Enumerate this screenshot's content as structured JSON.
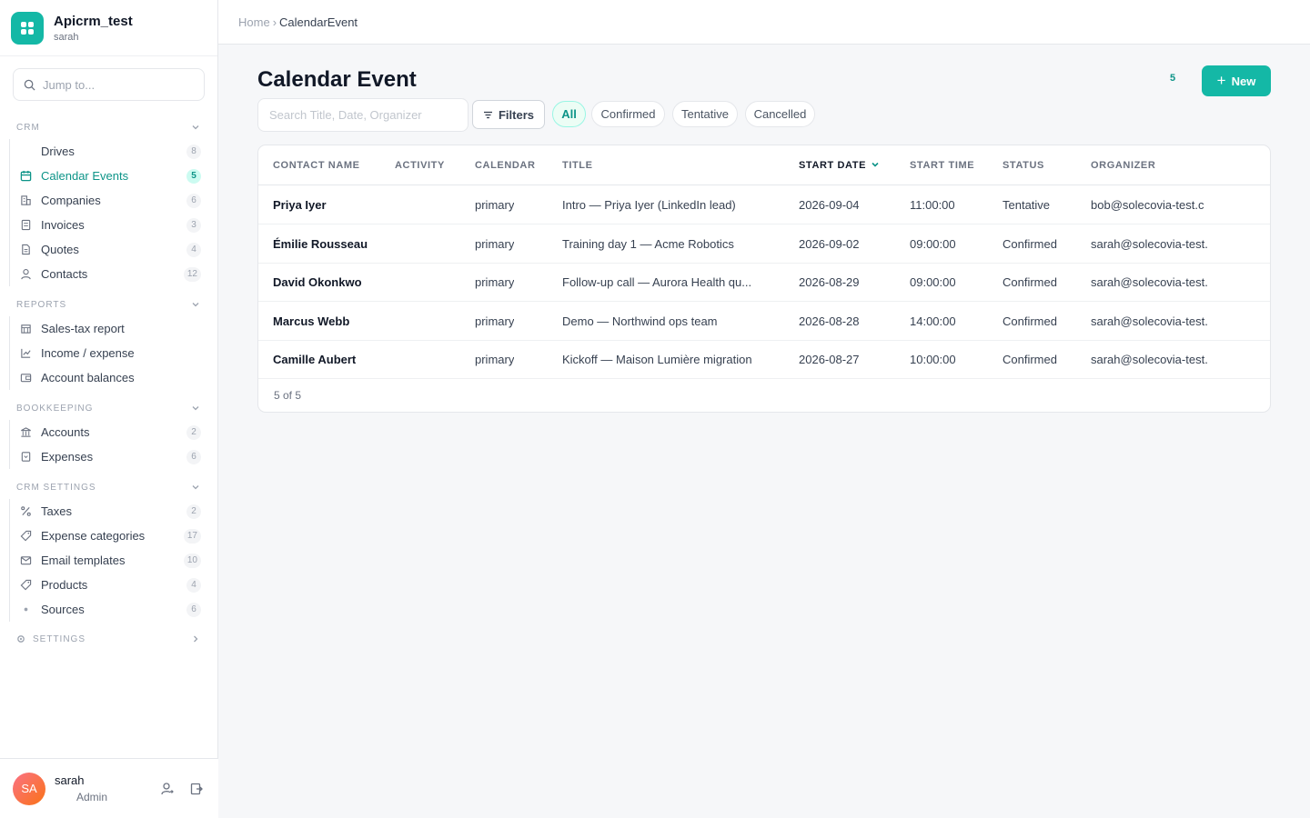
{
  "brand": {
    "title": "Apicrm_test",
    "subtitle": "sarah"
  },
  "jump": {
    "placeholder": "Jump to..."
  },
  "sections": {
    "crm": {
      "label": "CRM",
      "items": [
        {
          "label": "Drives",
          "count": "8"
        },
        {
          "label": "Calendar Events",
          "count": "5"
        },
        {
          "label": "Companies",
          "count": "6"
        },
        {
          "label": "Invoices",
          "count": "3"
        },
        {
          "label": "Quotes",
          "count": "4"
        },
        {
          "label": "Contacts",
          "count": "12"
        }
      ]
    },
    "reports": {
      "label": "REPORTS",
      "items": [
        {
          "label": "Sales-tax report"
        },
        {
          "label": "Income / expense"
        },
        {
          "label": "Account balances"
        }
      ]
    },
    "bookkeeping": {
      "label": "BOOKKEEPING",
      "items": [
        {
          "label": "Accounts",
          "count": "2"
        },
        {
          "label": "Expenses",
          "count": "6"
        }
      ]
    },
    "crm_settings": {
      "label": "CRM SETTINGS",
      "items": [
        {
          "label": "Taxes",
          "count": "2"
        },
        {
          "label": "Expense categories",
          "count": "17"
        },
        {
          "label": "Email templates",
          "count": "10"
        },
        {
          "label": "Products",
          "count": "4"
        },
        {
          "label": "Sources",
          "count": "6"
        }
      ]
    },
    "settings": {
      "label": "SETTINGS"
    }
  },
  "user": {
    "initials": "SA",
    "name": "sarah",
    "role": "Admin"
  },
  "breadcrumb": {
    "home": "Home",
    "sep": "›",
    "current": "CalendarEvent"
  },
  "page": {
    "title": "Calendar Event",
    "count": "5",
    "new_label": "New"
  },
  "toolbar": {
    "search_placeholder": "Search Title, Date, Organizer",
    "filters_label": "Filters",
    "chips": [
      "All",
      "Confirmed",
      "Tentative",
      "Cancelled"
    ]
  },
  "table": {
    "columns": [
      "CONTACT NAME",
      "ACTIVITY",
      "CALENDAR",
      "TITLE",
      "START DATE",
      "START TIME",
      "STATUS",
      "ORGANIZER"
    ],
    "rows": [
      {
        "contact": "Priya Iyer",
        "activity": "",
        "calendar": "primary",
        "title": "Intro — Priya Iyer (LinkedIn lead)",
        "start_date": "2026-09-04",
        "start_time": "11:00:00",
        "status": "Tentative",
        "organizer": "bob@solecovia-test.c"
      },
      {
        "contact": "Émilie Rousseau",
        "activity": "",
        "calendar": "primary",
        "title": "Training day 1 — Acme Robotics",
        "start_date": "2026-09-02",
        "start_time": "09:00:00",
        "status": "Confirmed",
        "organizer": "sarah@solecovia-test."
      },
      {
        "contact": "David Okonkwo",
        "activity": "",
        "calendar": "primary",
        "title": "Follow-up call — Aurora Health qu...",
        "start_date": "2026-08-29",
        "start_time": "09:00:00",
        "status": "Confirmed",
        "organizer": "sarah@solecovia-test."
      },
      {
        "contact": "Marcus Webb",
        "activity": "",
        "calendar": "primary",
        "title": "Demo — Northwind ops team",
        "start_date": "2026-08-28",
        "start_time": "14:00:00",
        "status": "Confirmed",
        "organizer": "sarah@solecovia-test."
      },
      {
        "contact": "Camille Aubert",
        "activity": "",
        "calendar": "primary",
        "title": "Kickoff — Maison Lumière migration",
        "start_date": "2026-08-27",
        "start_time": "10:00:00",
        "status": "Confirmed",
        "organizer": "sarah@solecovia-test."
      }
    ],
    "footer": "5 of 5"
  },
  "colors": {
    "accent": "#14b8a6",
    "accent_dark": "#0d9488"
  }
}
